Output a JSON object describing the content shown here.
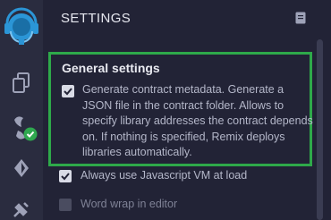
{
  "rail": {
    "items": [
      {
        "icon": "remix-logo-icon"
      },
      {
        "icon": "files-icon"
      },
      {
        "icon": "compiler-icon"
      },
      {
        "icon": "deploy-icon"
      },
      {
        "icon": "plugin-icon"
      }
    ],
    "accent": "#1e88c8"
  },
  "panel": {
    "title": "SETTINGS",
    "doc_icon": "document-icon"
  },
  "general": {
    "title": "General settings",
    "border_color": "#2ea94a",
    "metadata_label": "Generate contract metadata. Generate a JSON file in the contract folder. Allows to specify library addresses the contract depends on. If nothing is specified, Remix deploys libraries automatically.",
    "metadata_checked": true
  },
  "options": [
    {
      "label": "Always use Javascript VM at load",
      "checked": true
    },
    {
      "label": "Word wrap in editor",
      "checked": false
    }
  ]
}
